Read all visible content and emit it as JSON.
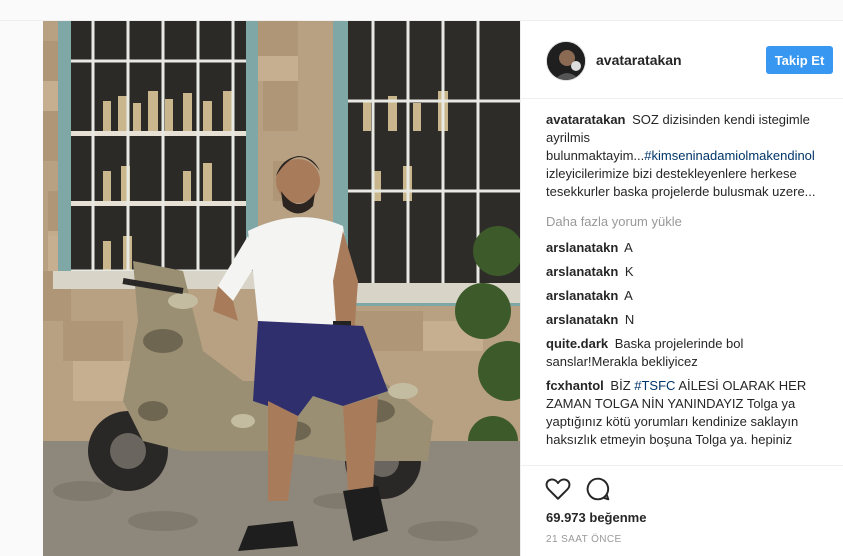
{
  "post": {
    "username": "avataratakan",
    "follow_label": "Takip Et",
    "load_more": "Daha fazla yorum yükle",
    "likes": "69.973 beğenme",
    "time": "21 SAAT ÖNCE"
  },
  "caption": {
    "user": "avataratakan",
    "text1": "SOZ dizisinden kendi istegimle ayrilmis bulunmaktayim...",
    "tag": "#kimseninadamiolmakendinol",
    "text2": " izleyicilerimize bizi destekleyenlere herkese tesekkurler baska projelerde bulusmak uzere..."
  },
  "comments": [
    {
      "user": "arslanatakn",
      "text": "A"
    },
    {
      "user": "arslanatakn",
      "text": "K"
    },
    {
      "user": "arslanatakn",
      "text": "A"
    },
    {
      "user": "arslanatakn",
      "text": "N"
    },
    {
      "user": "quite.dark",
      "text": "Baska projelerinde bol sanslar!Merakla bekliyicez"
    }
  ],
  "last_comment": {
    "user": "fcxhantol",
    "text1": "BİZ ",
    "tag": "#TSFC",
    "text2": " AİLESİ OLARAK HER ZAMAN TOLGA NİN YANINDAYIZ Tolga ya yaptığınız kötü yorumları kendinize saklayın haksızlık etmeyin boşuna Tolga ya. hepiniz"
  },
  "icons": {
    "like": "heart-icon",
    "comment": "comment-bubble-icon"
  },
  "colors": {
    "follow_button": "#3897f0",
    "hashtag": "#003569"
  }
}
